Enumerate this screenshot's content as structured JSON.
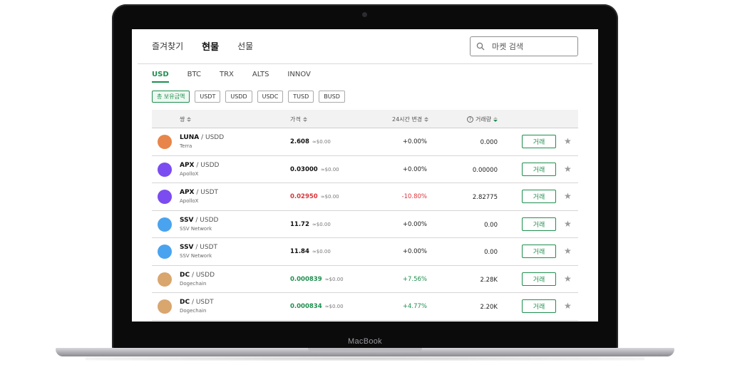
{
  "device": {
    "brand": "MacBook"
  },
  "nav": {
    "tabs": [
      {
        "label": "즐겨찾기",
        "active": false
      },
      {
        "label": "현물",
        "active": true
      },
      {
        "label": "선물",
        "active": false
      }
    ]
  },
  "search": {
    "placeholder": "마켓 검색"
  },
  "markets": {
    "tabs": [
      {
        "label": "USD",
        "active": true
      },
      {
        "label": "BTC",
        "active": false
      },
      {
        "label": "TRX",
        "active": false
      },
      {
        "label": "ALTS",
        "active": false
      },
      {
        "label": "INNOV",
        "active": false
      }
    ],
    "chips": [
      {
        "label": "총 보유금액",
        "active": true
      },
      {
        "label": "USDT",
        "active": false
      },
      {
        "label": "USDD",
        "active": false
      },
      {
        "label": "USDC",
        "active": false
      },
      {
        "label": "TUSD",
        "active": false
      },
      {
        "label": "BUSD",
        "active": false
      }
    ]
  },
  "table": {
    "headers": {
      "pair": "쌍",
      "price": "가격",
      "change": "24시간 변경",
      "volume": "거래량"
    },
    "rows": [
      {
        "base": "LUNA",
        "quote": "/ USDD",
        "name": "Terra",
        "price": "2.608",
        "approx": "≈$0.00",
        "change": "+0.00%",
        "volume": "0.000",
        "trend": "flat",
        "color": "#e8854a",
        "trade_label": "거래"
      },
      {
        "base": "APX",
        "quote": "/ USDD",
        "name": "ApolloX",
        "price": "0.03000",
        "approx": "≈$0.00",
        "change": "+0.00%",
        "volume": "0.00000",
        "trend": "flat",
        "color": "#7b4cf0",
        "trade_label": "거래"
      },
      {
        "base": "APX",
        "quote": "/ USDT",
        "name": "ApolloX",
        "price": "0.02950",
        "approx": "≈$0.00",
        "change": "-10.80%",
        "volume": "2.82775",
        "trend": "down",
        "color": "#7b4cf0",
        "trade_label": "거래"
      },
      {
        "base": "SSV",
        "quote": "/ USDD",
        "name": "SSV Network",
        "price": "11.72",
        "approx": "≈$0.00",
        "change": "+0.00%",
        "volume": "0.00",
        "trend": "flat",
        "color": "#4aa3ee",
        "trade_label": "거래"
      },
      {
        "base": "SSV",
        "quote": "/ USDT",
        "name": "SSV Network",
        "price": "11.84",
        "approx": "≈$0.00",
        "change": "+0.00%",
        "volume": "0.00",
        "trend": "flat",
        "color": "#4aa3ee",
        "trade_label": "거래"
      },
      {
        "base": "DC",
        "quote": "/ USDD",
        "name": "Dogechain",
        "price": "0.000839",
        "approx": "≈$0.00",
        "change": "+7.56%",
        "volume": "2.28K",
        "trend": "up",
        "color": "#d9a66e",
        "trade_label": "거래"
      },
      {
        "base": "DC",
        "quote": "/ USDT",
        "name": "Dogechain",
        "price": "0.000834",
        "approx": "≈$0.00",
        "change": "+4.77%",
        "volume": "2.20K",
        "trend": "up",
        "color": "#d9a66e",
        "trade_label": "거래"
      }
    ]
  },
  "colors": {
    "accent": "#1e8f4e",
    "negative": "#d9353b"
  }
}
